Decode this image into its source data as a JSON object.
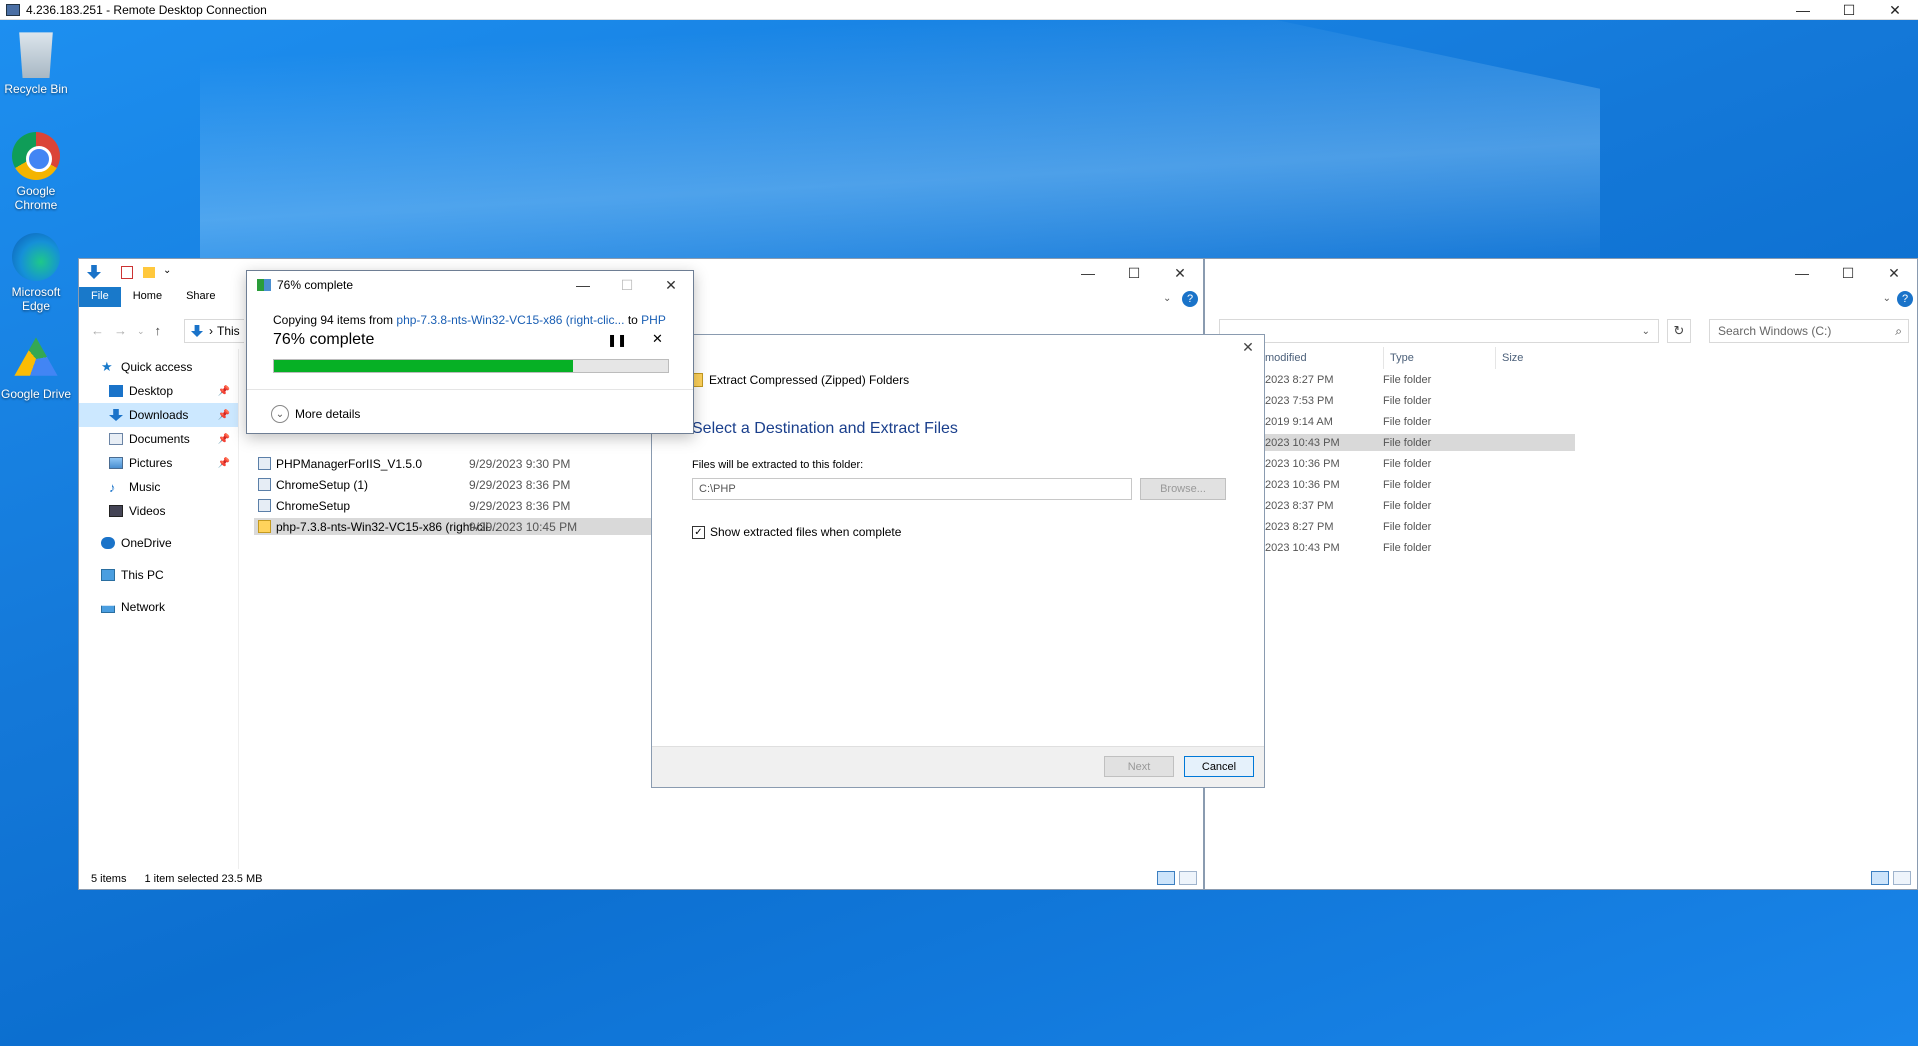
{
  "rdp": {
    "title": "4.236.183.251 - Remote Desktop Connection",
    "min": "—",
    "max": "☐",
    "close": "✕"
  },
  "desktop_icons": [
    {
      "label": "Recycle Bin"
    },
    {
      "label": "Google Chrome"
    },
    {
      "label": "Microsoft Edge"
    },
    {
      "label": "Google Drive"
    }
  ],
  "explorer_left": {
    "tabs": [
      "File",
      "Home",
      "Share"
    ],
    "address": "This",
    "nav": {
      "quick_access": "Quick access",
      "items": [
        {
          "label": "Desktop"
        },
        {
          "label": "Downloads"
        },
        {
          "label": "Documents"
        },
        {
          "label": "Pictures"
        },
        {
          "label": "Music"
        },
        {
          "label": "Videos"
        }
      ],
      "onedrive": "OneDrive",
      "this_pc": "This PC",
      "network": "Network"
    },
    "files": [
      {
        "name": "PHPManagerForIIS_V1.5.0",
        "date": "9/29/2023 9:30 PM"
      },
      {
        "name": "ChromeSetup (1)",
        "date": "9/29/2023 8:36 PM"
      },
      {
        "name": "ChromeSetup",
        "date": "9/29/2023 8:36 PM"
      },
      {
        "name": "php-7.3.8-nts-Win32-VC15-x86 (right-cli...",
        "date": "9/29/2023 10:45 PM"
      }
    ],
    "status": {
      "items": "5 items",
      "selected": "1 item selected  23.5 MB"
    }
  },
  "explorer_right": {
    "search_placeholder": "Search Windows (C:)",
    "columns": {
      "modified": "modified",
      "type": "Type",
      "size": "Size"
    },
    "rows": [
      {
        "date": "2023 8:27 PM",
        "type": "File folder"
      },
      {
        "date": "2023 7:53 PM",
        "type": "File folder"
      },
      {
        "date": "2019 9:14 AM",
        "type": "File folder"
      },
      {
        "date": "2023 10:43 PM",
        "type": "File folder"
      },
      {
        "date": "2023 10:36 PM",
        "type": "File folder"
      },
      {
        "date": "2023 10:36 PM",
        "type": "File folder"
      },
      {
        "date": "2023 8:37 PM",
        "type": "File folder"
      },
      {
        "date": "2023 8:27 PM",
        "type": "File folder"
      },
      {
        "date": "2023 10:43 PM",
        "type": "File folder"
      }
    ]
  },
  "progress": {
    "title": "76% complete",
    "line_prefix": "Copying 94 items from ",
    "line_source": "php-7.3.8-nts-Win32-VC15-x86 (right-clic...",
    "line_mid": " to ",
    "line_dest": "PHP",
    "big": "76% complete",
    "percent": 76,
    "more_details": "More details"
  },
  "wizard": {
    "title": "Extract Compressed (Zipped) Folders",
    "heading": "Select a Destination and Extract Files",
    "label": "Files will be extracted to this folder:",
    "path": "C:\\PHP",
    "browse": "Browse...",
    "show_files": "Show extracted files when complete",
    "next": "Next",
    "cancel": "Cancel"
  },
  "colors": {
    "progress_fill": "#06b025",
    "file_tab": "#1979ca",
    "link": "#1a5fb4"
  }
}
